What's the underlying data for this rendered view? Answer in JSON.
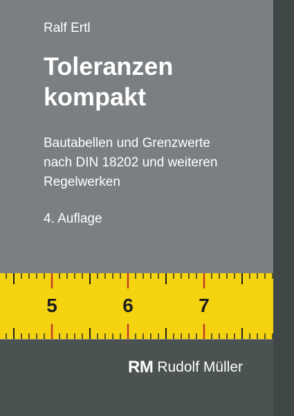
{
  "cover": {
    "author": "Ralf Ertl",
    "title_lines": [
      "Toleranzen",
      "kompakt"
    ],
    "subtitle_lines": [
      "Bautabellen und Grenzwerte",
      "nach DIN 18202 und weiteren",
      "Regelwerken"
    ],
    "edition": "4. Auflage"
  },
  "ruler": {
    "numbers": [
      "5",
      "6",
      "7"
    ],
    "colors": {
      "tape": "#f4d411",
      "ticks": "#1f1f1f",
      "highlight_ticks": "#c0392b"
    }
  },
  "publisher": {
    "logo": "RM",
    "name": "Rudolf Müller"
  },
  "colors": {
    "panel": "#7b7f82",
    "strip": "#3f4846",
    "band": "#4a5352",
    "text": "#ffffff"
  }
}
